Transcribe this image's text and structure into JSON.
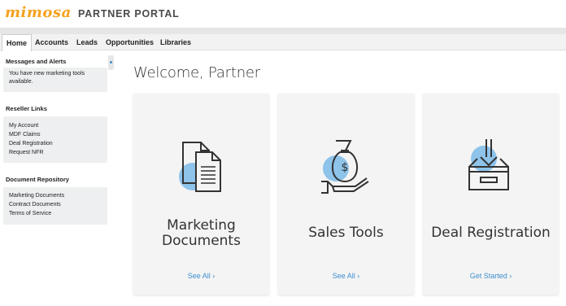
{
  "header": {
    "logo": "mimosa",
    "portal_title": "PARTNER PORTAL"
  },
  "nav": {
    "tabs": [
      {
        "label": "Home",
        "active": true
      },
      {
        "label": "Accounts"
      },
      {
        "label": "Leads"
      },
      {
        "label": "Opportunities"
      },
      {
        "label": "Libraries"
      }
    ]
  },
  "sidebar": {
    "messages": {
      "title": "Messages and Alerts",
      "text_line1": "You have new marketing tools",
      "text_line2": "available."
    },
    "reseller": {
      "title": "Reseller Links",
      "links": [
        "My Account",
        "MDF Claims",
        "Deal Registration",
        "Request NFR"
      ]
    },
    "repository": {
      "title": "Document Repository",
      "links": [
        "Marketing Documents",
        "Contract Documents",
        "Terms of Service"
      ]
    }
  },
  "main": {
    "welcome": "Welcome, Partner",
    "cards": [
      {
        "title_line1": "Marketing",
        "title_line2": "Documents",
        "link": "See All ›",
        "icon": "documents-icon"
      },
      {
        "title_line1": "Sales Tools",
        "title_line2": "",
        "link": "See All ›",
        "icon": "money-bag-hand-icon"
      },
      {
        "title_line1": "Deal Registration",
        "title_line2": "",
        "link": "Get Started ›",
        "icon": "inbox-download-icon"
      }
    ]
  },
  "colors": {
    "brand": "#f5a11c",
    "accent_blue": "#3d8fd1",
    "icon_circle": "#8ec3ea",
    "card_bg": "#f4f4f4"
  }
}
